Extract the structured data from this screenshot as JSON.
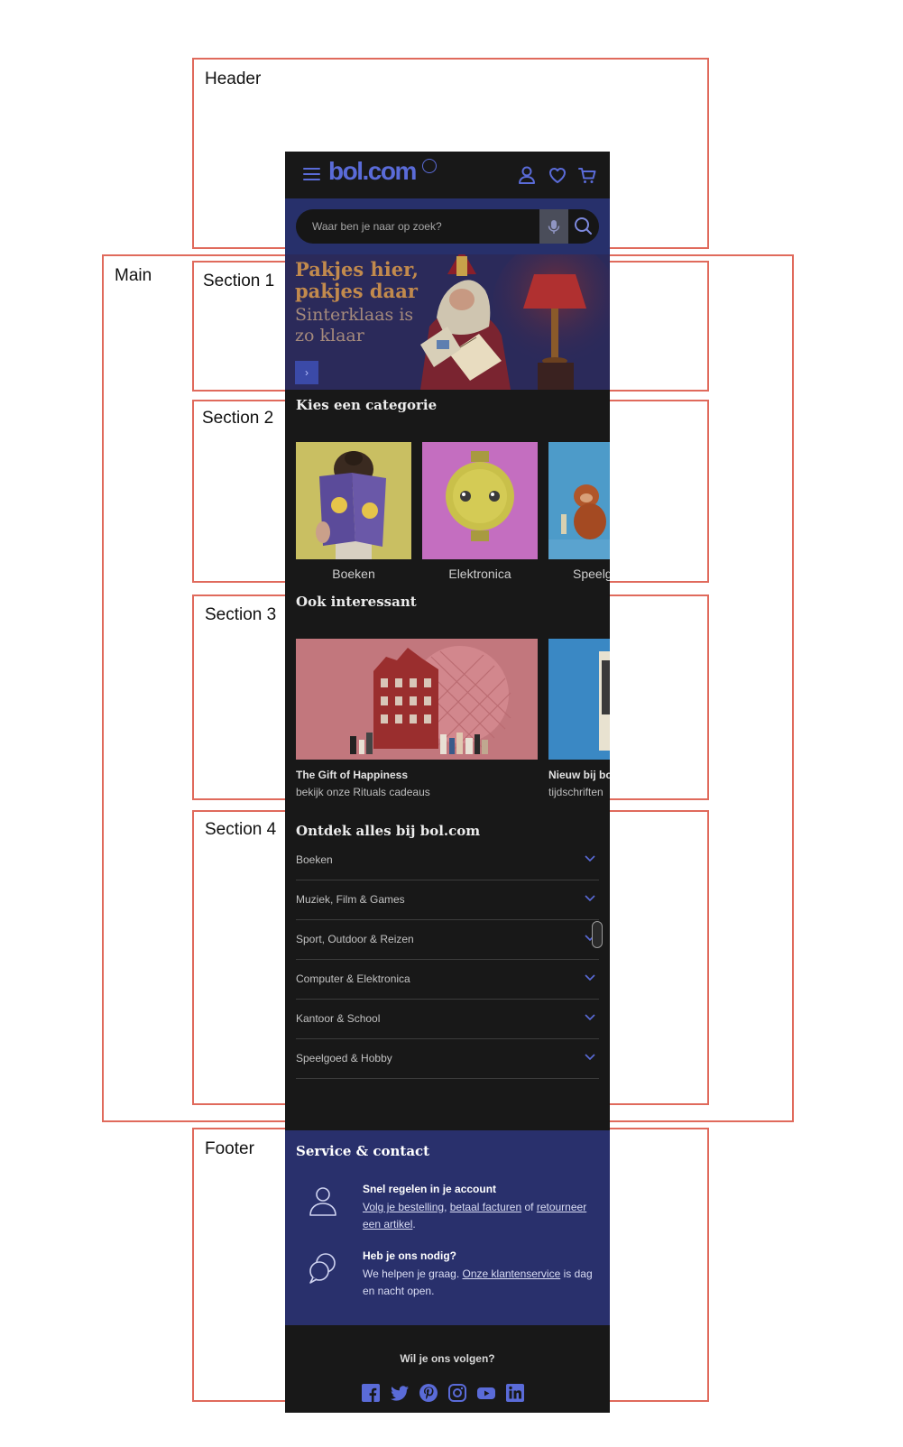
{
  "annotations": {
    "header": "Header",
    "main": "Main",
    "section1": "Section 1",
    "section2": "Section 2",
    "section3": "Section 3",
    "section4": "Section 4",
    "footer": "Footer"
  },
  "colors": {
    "brand": "#5a6bd8",
    "dark_bg": "#181818",
    "navy": "#29306c",
    "annotation_border": "#e06a5c"
  },
  "header": {
    "logo": "bol.com",
    "search": {
      "placeholder": "Waar ben je naar op zoek?"
    },
    "icons": [
      "menu-icon",
      "account-icon",
      "wishlist-heart-icon",
      "cart-icon",
      "microphone-icon",
      "search-icon"
    ]
  },
  "hero": {
    "headline": "Pakjes hier, pakjes daar",
    "subline": "Sinterklaas is zo klaar",
    "button_glyph": "›"
  },
  "categories": {
    "title": "Kies een categorie",
    "items": [
      {
        "label": "Boeken"
      },
      {
        "label": "Elektronica"
      },
      {
        "label": "Speelg"
      }
    ]
  },
  "interesting": {
    "title": "Ook interessant",
    "items": [
      {
        "title": "The Gift of Happiness",
        "subtitle": "bekijk onze Rituals cadeaus"
      },
      {
        "title": "Nieuw bij bo",
        "subtitle": "tijdschriften"
      }
    ]
  },
  "discover": {
    "title": "Ontdek alles bij bol.com",
    "items": [
      {
        "label": "Boeken"
      },
      {
        "label": "Muziek, Film & Games"
      },
      {
        "label": "Sport, Outdoor & Reizen"
      },
      {
        "label": "Computer & Elektronica"
      },
      {
        "label": "Kantoor & School"
      },
      {
        "label": "Speelgoed & Hobby"
      }
    ]
  },
  "service": {
    "title": "Service & contact",
    "account": {
      "heading": "Snel regelen in je account",
      "link1": "Volg je bestelling",
      "sep1": ", ",
      "link2": "betaal facturen",
      "sep2": " of ",
      "link3": "retourneer een artikel",
      "end": "."
    },
    "help": {
      "heading": "Heb je ons nodig?",
      "pre": "We helpen je graag. ",
      "link": "Onze klantenservice",
      "post": " is dag en nacht open."
    }
  },
  "follow": {
    "title": "Wil je ons volgen?",
    "icons": [
      "facebook-icon",
      "twitter-icon",
      "pinterest-icon",
      "instagram-icon",
      "youtube-icon",
      "linkedin-icon"
    ]
  }
}
